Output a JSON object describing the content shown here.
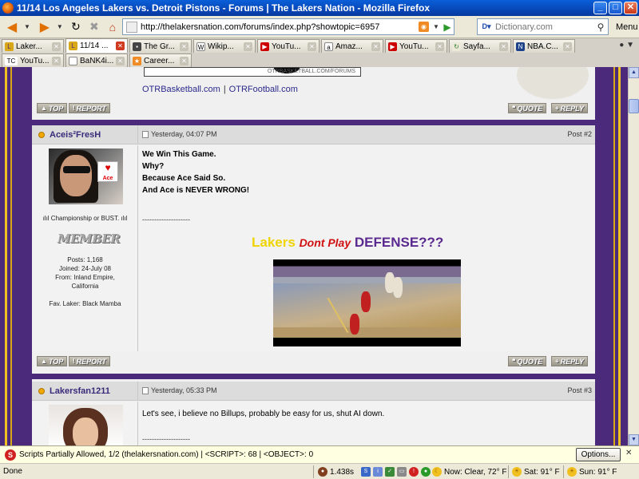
{
  "window": {
    "title": "11/14 Los Angeles Lakers vs. Detroit Pistons - Forums | The Lakers Nation - Mozilla Firefox",
    "minimize": "_",
    "maximize": "□",
    "close": "✕"
  },
  "navbar": {
    "url": "http://thelakersnation.com/forums/index.php?showtopic=6957",
    "search_placeholder": "Dictionary.com",
    "menu_label": "Menu"
  },
  "tabs_row1": [
    {
      "label": "Laker...",
      "icon": "tln-icon",
      "active": false
    },
    {
      "label": "11/14 ...",
      "icon": "tln-icon",
      "active": true
    },
    {
      "label": "The Gr...",
      "icon": "page-icon",
      "active": false
    },
    {
      "label": "Wikip...",
      "icon": "wikipedia-icon",
      "active": false
    },
    {
      "label": "YouTu...",
      "icon": "youtube-icon",
      "active": false
    },
    {
      "label": "Amaz...",
      "icon": "amazon-icon",
      "active": false
    },
    {
      "label": "YouTu...",
      "icon": "youtube-icon",
      "active": false
    },
    {
      "label": "Sayfa...",
      "icon": "refresh-icon",
      "active": false
    },
    {
      "label": "NBA.C...",
      "icon": "nba-icon",
      "active": false
    }
  ],
  "tabs_row2": [
    {
      "label": "YouTu...",
      "icon": "tc-icon",
      "prefix": "TC"
    },
    {
      "label": "BaNK4i...",
      "icon": "page-icon",
      "prefix": ""
    },
    {
      "label": "Career...",
      "icon": "bookmark-icon",
      "prefix": ""
    }
  ],
  "page": {
    "banner_text": "OTRBASKETBALL.COM/FORUMS",
    "links": [
      "OTRBasketball.com",
      "OTRFootball.com"
    ],
    "link_separator": "|",
    "btn_top": "TOP",
    "btn_report": "REPORT",
    "btn_quote": "QUOTE",
    "btn_reply": "REPLY"
  },
  "posts": [
    {
      "username": "Aceis²FresH",
      "time": "Yesterday, 04:07 PM",
      "post_no": "Post #2",
      "avatar_sign": "Ace",
      "user_title": "ılıl Championship or BUST. ılıl",
      "rank": "MEMBER",
      "posts_count": "Posts: 1,168",
      "joined": "Joined: 24-July 08",
      "from": "From: Inland Empire, California",
      "fav": "Fav. Laker: Black Mamba",
      "lines": [
        "We Win This Game.",
        "Why?",
        "Because Ace Said So.",
        "And Ace is NEVER WRONG!"
      ],
      "dashes": "--------------------",
      "sig_word1": "Lakers",
      "sig_word2": "Dont Play",
      "sig_word3": "DEFENSE???"
    },
    {
      "username": "Lakersfan1211",
      "time": "Yesterday, 05:33 PM",
      "post_no": "Post #3",
      "lines": [
        "Let's see, i believe no Billups, probably be easy for us, shut AI down."
      ],
      "dashes": "--------------------"
    }
  ],
  "notification": {
    "text": "Scripts Partially Allowed, 1/2 (thelakersnation.com) | <SCRIPT>: 68 | <OBJECT>: 0",
    "options": "Options...",
    "close": "✕"
  },
  "status": {
    "done": "Done",
    "load_time": "1.438s",
    "weather_now": "Now: Clear, 72° F",
    "weather_sat": "Sat: 91° F",
    "weather_sun": "Sun: 91° F"
  },
  "colors": {
    "lakers_purple": "#4b2a7b",
    "lakers_gold": "#f0c020",
    "titlebar_blue": "#0a5fd8"
  }
}
